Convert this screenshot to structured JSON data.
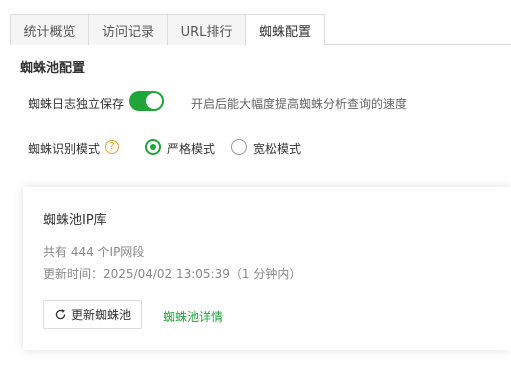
{
  "tabs": [
    {
      "label": "统计概览",
      "active": false
    },
    {
      "label": "访问记录",
      "active": false
    },
    {
      "label": "URL排行",
      "active": false
    },
    {
      "label": "蜘蛛配置",
      "active": true
    }
  ],
  "section": {
    "title": "蜘蛛池配置"
  },
  "log_toggle": {
    "label": "蜘蛛日志独立保存",
    "enabled": true,
    "hint": "开启后能大幅度提高蜘蛛分析查询的速度"
  },
  "mode": {
    "label": "蜘蛛识别模式",
    "help_icon": "question-circle-icon",
    "options": [
      {
        "label": "严格模式",
        "selected": true
      },
      {
        "label": "宽松模式",
        "selected": false
      }
    ]
  },
  "card": {
    "title": "蜘蛛池IP库",
    "count_text": "共有 444 个IP网段",
    "updated_text": "更新时间：2025/04/02 13:05:39（1 分钟内）",
    "update_button": "更新蜘蛛池",
    "details_link": "蜘蛛池详情"
  },
  "colors": {
    "accent": "#20a53a",
    "help": "#f0a020",
    "border": "#dcdcdc"
  }
}
